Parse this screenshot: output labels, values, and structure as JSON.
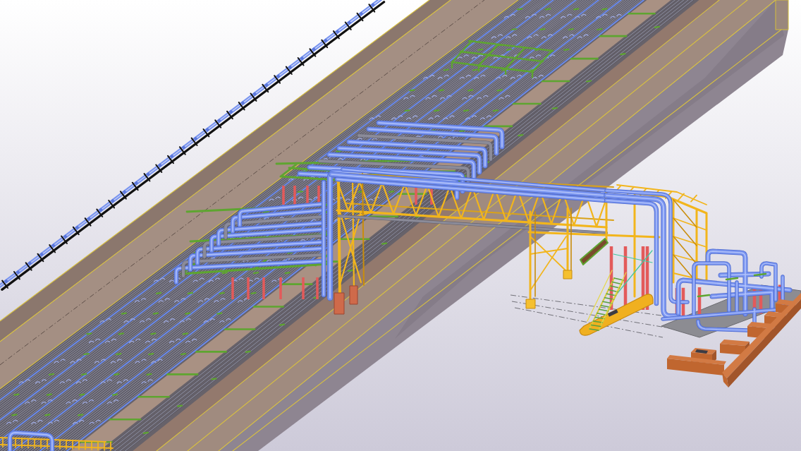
{
  "scene": {
    "parts": [
      {
        "kind": "trench"
      },
      {
        "kind": "elevated-pipeline"
      },
      {
        "kind": "pipe-rack"
      },
      {
        "kind": "process-unit"
      }
    ]
  }
}
